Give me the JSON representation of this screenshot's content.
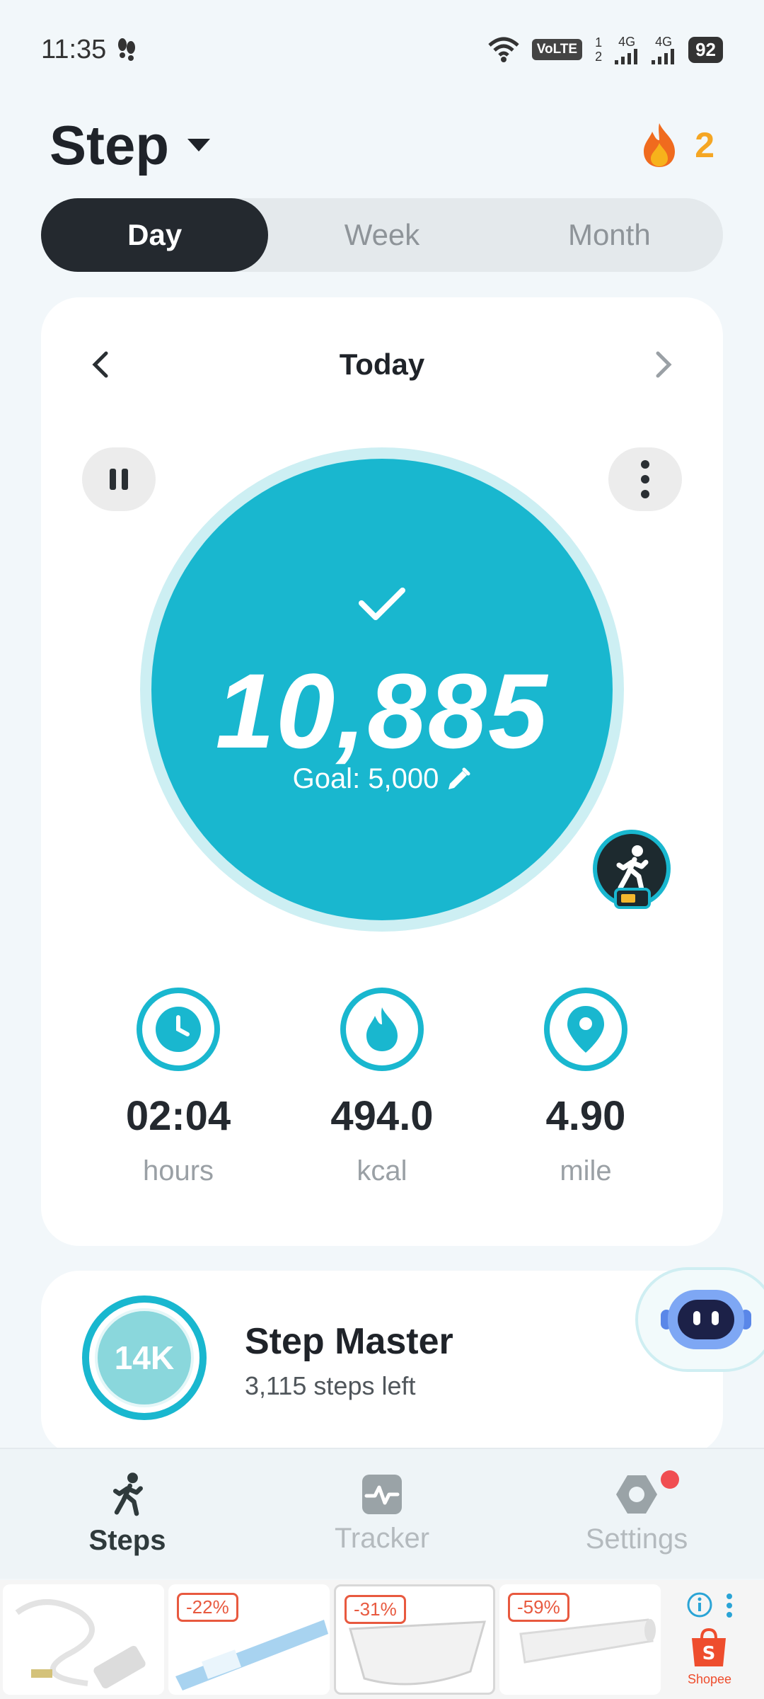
{
  "status_bar": {
    "time": "11:35",
    "volte": "VoLTE",
    "sim1": "1",
    "sim2": "2",
    "net1": "4G",
    "net2": "4G",
    "battery": "92"
  },
  "header": {
    "title": "Step",
    "streak_count": "2"
  },
  "period_tabs": {
    "day": "Day",
    "week": "Week",
    "month": "Month",
    "active": "Day"
  },
  "day_nav": {
    "label": "Today"
  },
  "progress": {
    "steps": "10,885",
    "goal": "Goal: 5,000",
    "ring_color": "#19b7cf"
  },
  "metrics": [
    {
      "value": "02:04",
      "unit": "hours",
      "icon": "clock-icon"
    },
    {
      "value": "494.0",
      "unit": "kcal",
      "icon": "flame-icon"
    },
    {
      "value": "4.90",
      "unit": "mile",
      "icon": "location-pin-icon"
    }
  ],
  "achievement": {
    "badge": "14K",
    "title": "Step Master",
    "subtitle": "3,115 steps left"
  },
  "bottom_nav": {
    "steps": "Steps",
    "tracker": "Tracker",
    "settings": "Settings"
  },
  "ads": {
    "discounts": [
      "-22%",
      "-31%",
      "-59%"
    ],
    "brand": "Shopee"
  },
  "colors": {
    "accent": "#19b7cf",
    "dark": "#24292f",
    "streak": "#f5a623"
  }
}
